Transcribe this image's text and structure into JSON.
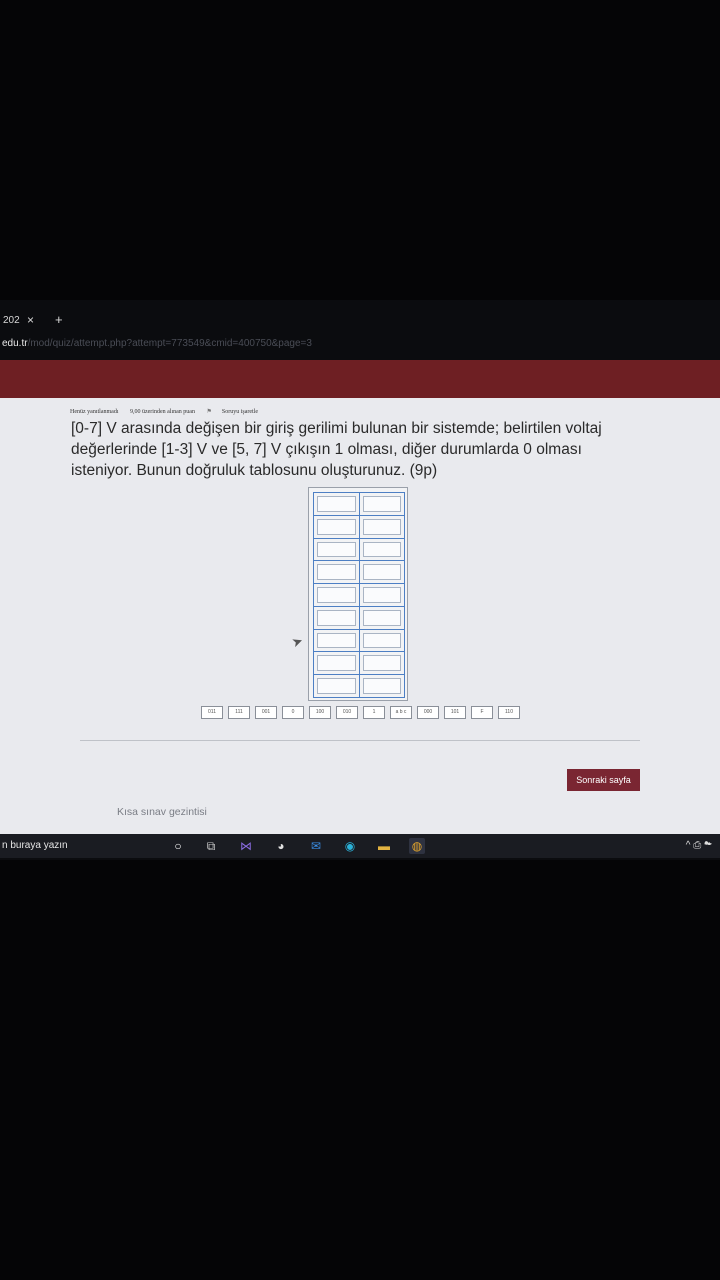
{
  "browser": {
    "tab_title": "202",
    "tab_close": "×",
    "new_tab": "+",
    "url_host": "edu.tr",
    "url_path": "/mod/quiz/attempt.php?attempt=773549&cmid=400750&page=3"
  },
  "question": {
    "status": "Henüz yanıtlanmadı",
    "points": "9,00 üzerinden alınan puan",
    "flag_label": "Soruyu işaretle",
    "text": "[0-7] V arasında değişen bir giriş gerilimi bulunan bir sistemde; belirtilen voltaj değerlerinde [1-3] V ve [5, 7] V çıkışın 1 olması, diğer durumlarda 0 olması isteniyor. Bunun doğruluk tablosunu oluşturunuz. (9p)"
  },
  "drag_options": [
    "011",
    "111",
    "001",
    "0",
    "100",
    "010",
    "1",
    "a b c",
    "000",
    "101",
    "F",
    "110"
  ],
  "buttons": {
    "next": "Sonraki sayfa"
  },
  "navigation": {
    "quiz_nav_label": "Kısa sınav gezintisi"
  },
  "taskbar": {
    "search_placeholder": "n buraya yazın"
  },
  "colors": {
    "header": "#6e1f23",
    "next_button": "#7a2632",
    "table_lines": "#4d7fc4"
  }
}
